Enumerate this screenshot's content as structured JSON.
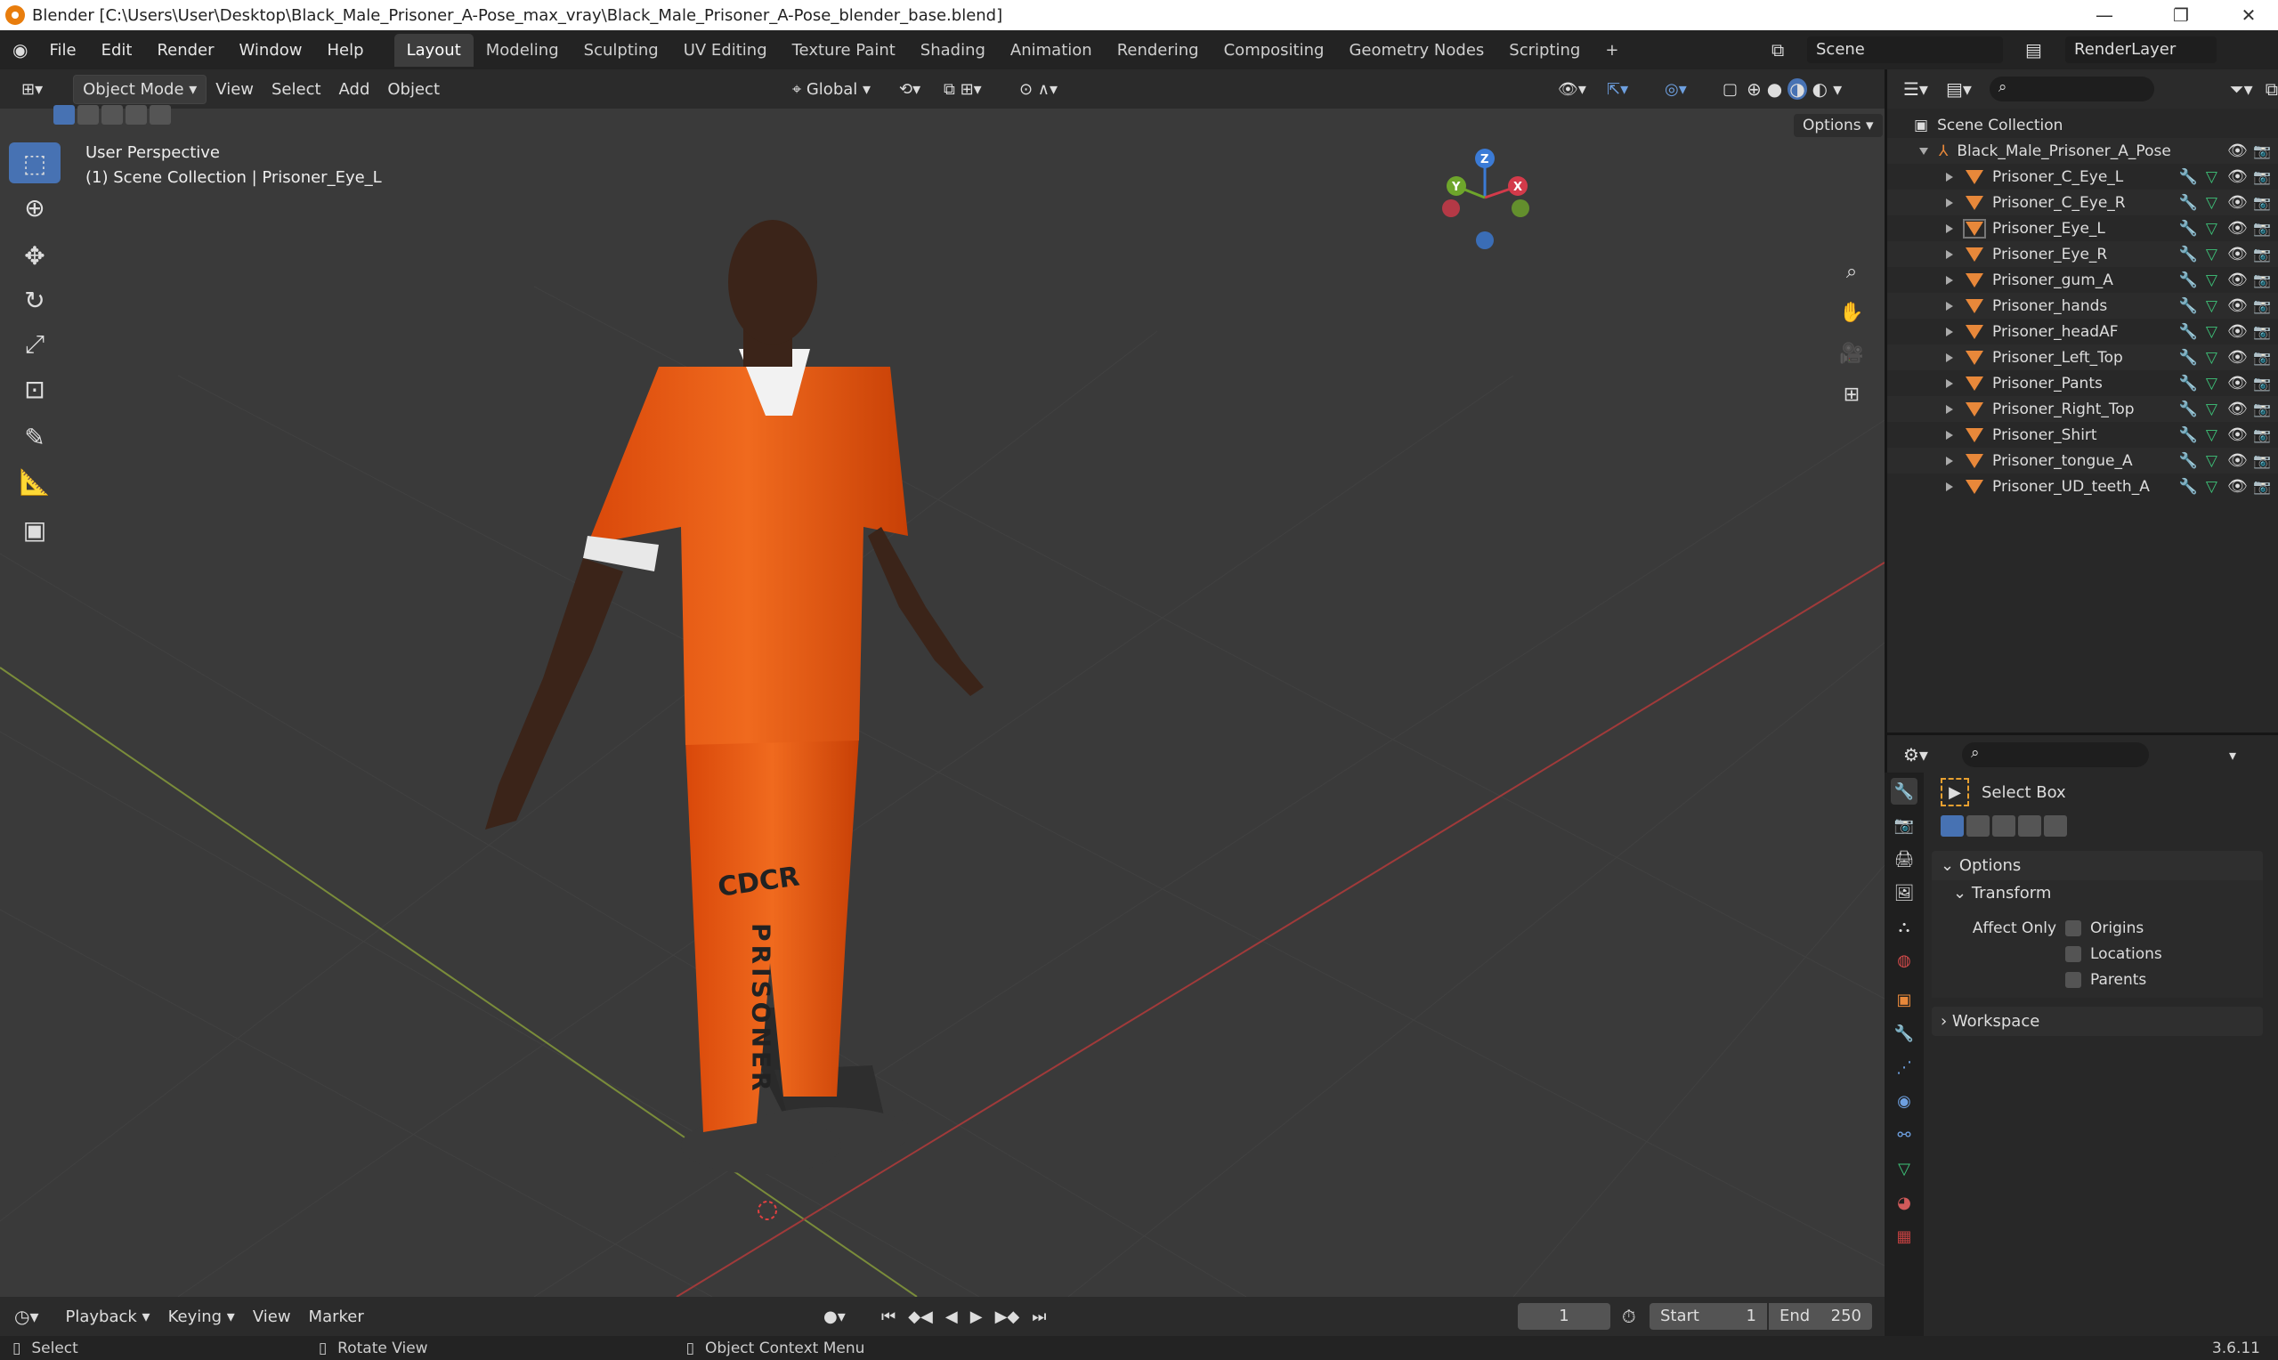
{
  "window": {
    "title": "Blender [C:\\Users\\User\\Desktop\\Black_Male_Prisoner_A-Pose_max_vray\\Black_Male_Prisoner_A-Pose_blender_base.blend]",
    "controls": [
      "—",
      "❐",
      "✕"
    ]
  },
  "menus": [
    "File",
    "Edit",
    "Render",
    "Window",
    "Help"
  ],
  "workspaces": [
    "Layout",
    "Modeling",
    "Sculpting",
    "UV Editing",
    "Texture Paint",
    "Shading",
    "Animation",
    "Rendering",
    "Compositing",
    "Geometry Nodes",
    "Scripting"
  ],
  "active_workspace": "Layout",
  "add_workspace": "+",
  "scene": {
    "name": "Scene",
    "render_layer": "RenderLayer"
  },
  "viewport_header": {
    "mode": "Object Mode",
    "menus": [
      "View",
      "Select",
      "Add",
      "Object"
    ],
    "transform": "Global",
    "options": "Options"
  },
  "viewport": {
    "perspective": "User Perspective",
    "collection_info": "(1) Scene Collection | Prisoner_Eye_L",
    "gizmo": {
      "z": "Z",
      "y": "Y",
      "x": "X"
    },
    "pants_text_1": "CDCR",
    "pants_text_2": "PRISONER"
  },
  "tools": [
    "select-box",
    "cursor",
    "move",
    "rotate",
    "scale",
    "transform",
    "annotate",
    "measure",
    "add-cube"
  ],
  "outliner": {
    "root": "Scene Collection",
    "collection": "Black_Male_Prisoner_A_Pose",
    "items": [
      "Prisoner_C_Eye_L",
      "Prisoner_C_Eye_R",
      "Prisoner_Eye_L",
      "Prisoner_Eye_R",
      "Prisoner_gum_A",
      "Prisoner_hands",
      "Prisoner_headAF",
      "Prisoner_Left_Top",
      "Prisoner_Pants",
      "Prisoner_Right_Top",
      "Prisoner_Shirt",
      "Prisoner_tongue_A",
      "Prisoner_UD_teeth_A"
    ],
    "selected": "Prisoner_Eye_L"
  },
  "properties": {
    "tool_name": "Select Box",
    "options_label": "Options",
    "transform_label": "Transform",
    "affect_only": "Affect Only",
    "checkboxes": [
      "Origins",
      "Locations",
      "Parents"
    ],
    "workspace_label": "Workspace"
  },
  "timeline": {
    "menus": [
      "Playback",
      "Keying",
      "View",
      "Marker"
    ],
    "current_frame": "1",
    "start_label": "Start",
    "start": "1",
    "end_label": "End",
    "end": "250"
  },
  "status": {
    "select": "Select",
    "rotate": "Rotate View",
    "context": "Object Context Menu",
    "version": "3.6.11"
  },
  "colors": {
    "accent": "#4772b3",
    "mesh": "#e8883a",
    "orange_suit": "#e8560f"
  }
}
